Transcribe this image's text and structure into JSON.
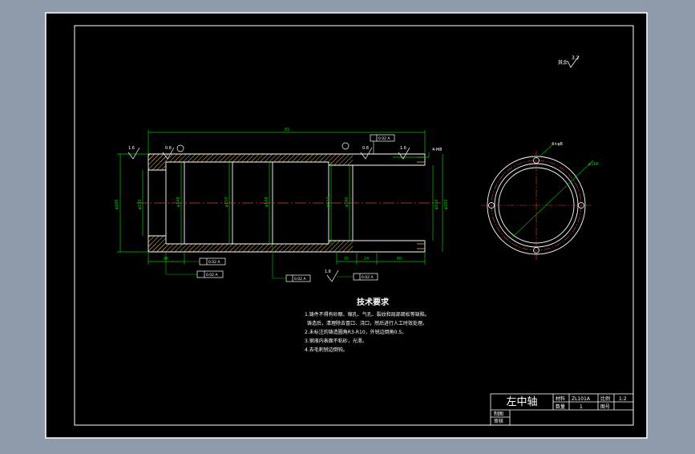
{
  "colors": {
    "background": "#8f9aaa",
    "sheet": "#000000",
    "line": "#ffffff",
    "dimension": "#00c800",
    "hatch": "#e6b450",
    "centerline": "#d84040",
    "text": "#ffffff"
  },
  "drawing": {
    "roughness_label": "其余",
    "roughness_value": "3.2",
    "overall_length": "65",
    "dim_46": "46",
    "dim_35": "35",
    "dim_24": "24",
    "dim_80": "80",
    "outer_dia": "φ186",
    "bore_dia": "φ130",
    "inner_left": "φ148",
    "mid_dia": "φ150",
    "inner_right": "φ148",
    "right_inner": "φ144",
    "right_outer": "φ180",
    "thread_note": "4-M8",
    "end_view_hole": "4×φ8",
    "end_view_dia": "φ166",
    "tolerance_1": "0.02 A",
    "tolerance_2": "0.02 A",
    "tolerance_3": "0.02 A",
    "tolerance_4": "0.02 A",
    "datum_label": "A",
    "roughness_1": "1.6",
    "roughness_2": "0.8",
    "roughness_3": "0.8",
    "roughness_4": "1.6",
    "roughness_5": "1.6"
  },
  "requirements": {
    "title": "技术要求",
    "items": [
      "1.铸件不得有砂眼、缩孔、气孔、裂纹和局部疏松等缺陷。",
      "铸造后，清理除去冒口、浇口，然后进行人工时效处理。",
      "2.未标注的铸造圆角R3-R10，外锐边倒角0.5。",
      "3.钢液内表面不粘砂，光滑。",
      "4.去毛刺锐边倒钝。"
    ]
  },
  "title_block": {
    "part_name": "左中轴",
    "material_label": "材料",
    "material_value": "ZL101A",
    "scale_label": "比例",
    "scale_value": "1:2",
    "quantity_label": "数量",
    "quantity_value": "1",
    "drawing_no_label": "图号",
    "drawing_no_value": "",
    "designer_label": "制图",
    "checker_label": "审核"
  }
}
